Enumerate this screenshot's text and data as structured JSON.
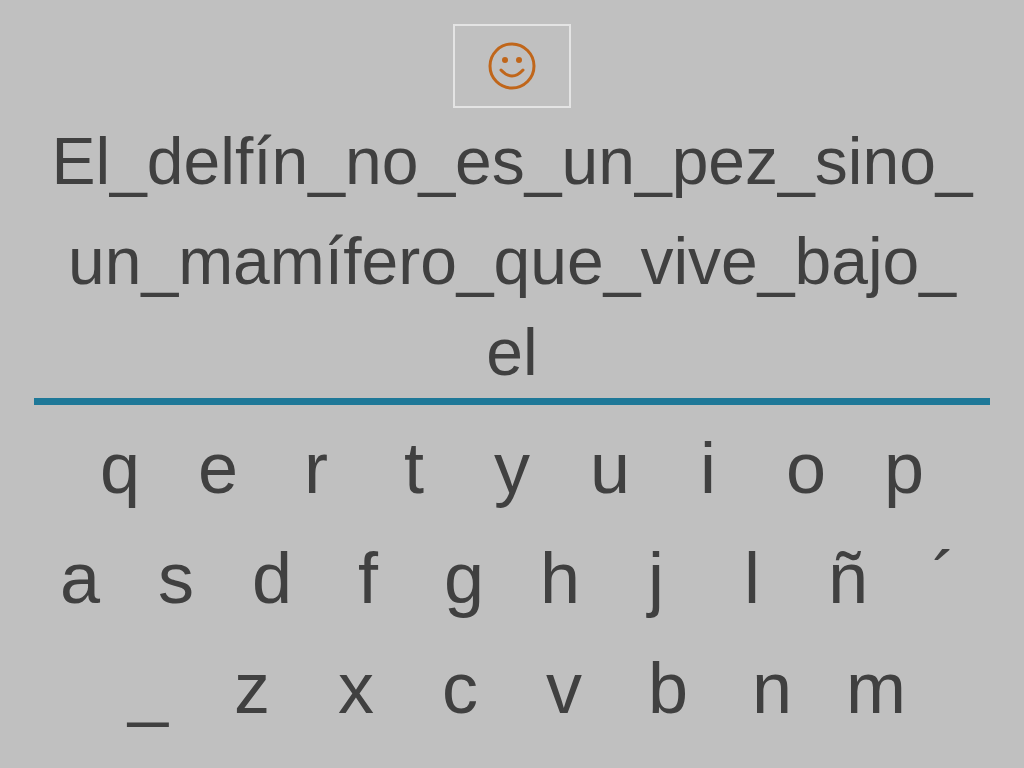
{
  "sentence_lines": [
    "El_delfín_no_es_un_pez_sino_",
    "un_mamífero_que_vive_bajo_",
    "el"
  ],
  "keyboard_rows": [
    [
      "q",
      "e",
      "r",
      "t",
      "y",
      "u",
      "i",
      "o",
      "p"
    ],
    [
      "a",
      "s",
      "d",
      "f",
      "g",
      "h",
      "j",
      "l",
      "ñ",
      "´"
    ],
    [
      "_",
      "z",
      "x",
      "c",
      "v",
      "b",
      "n",
      "m"
    ]
  ]
}
